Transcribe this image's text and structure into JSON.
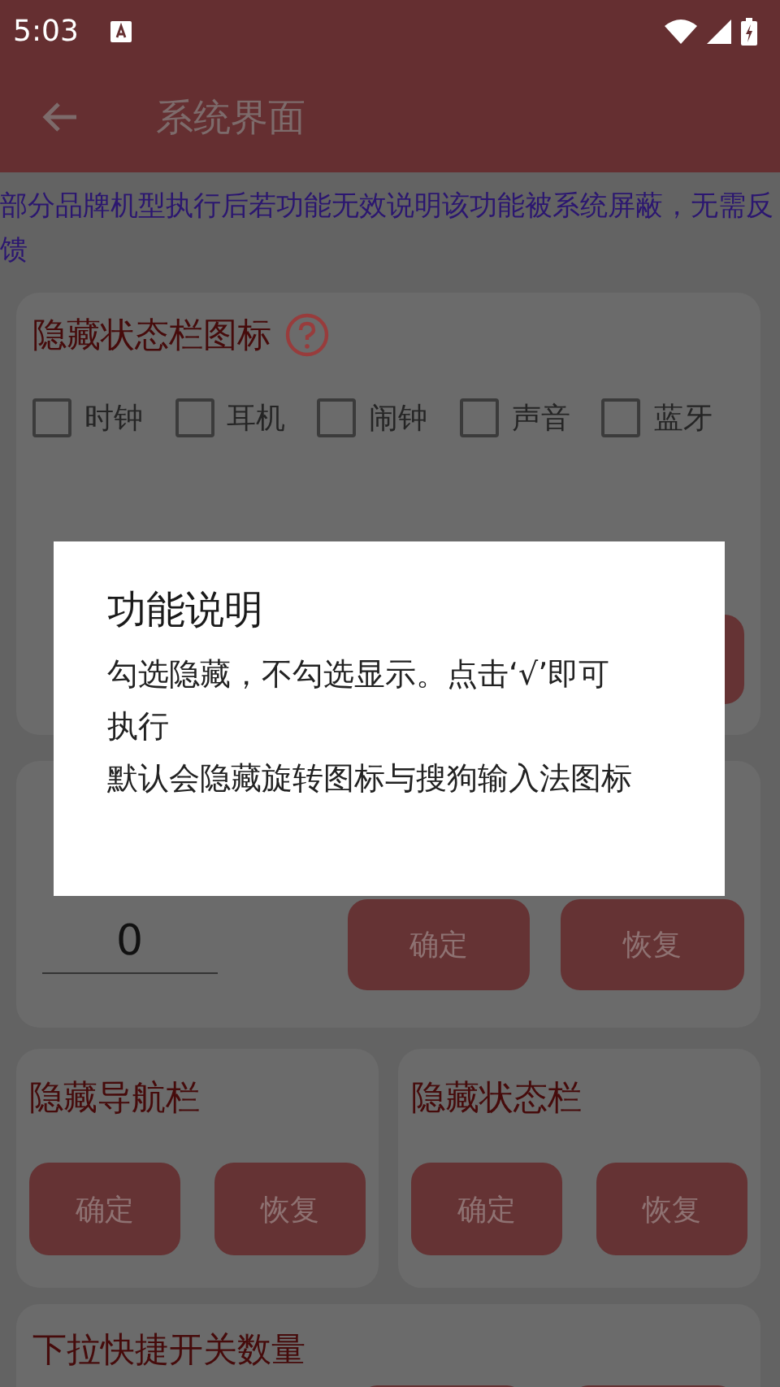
{
  "status_bar": {
    "time": "5:03"
  },
  "app_bar": {
    "title": "系统界面"
  },
  "notice": "部分品牌机型执行后若功能无效说明该功能被系统屏蔽，无需反馈",
  "icon_card": {
    "title": "隐藏状态栏图标",
    "rows": [
      [
        {
          "label": "时钟",
          "checked": false
        },
        {
          "label": "耳机",
          "checked": false
        },
        {
          "label": "闹钟",
          "checked": false
        },
        {
          "label": "声音",
          "checked": false
        },
        {
          "label": "蓝牙",
          "checked": false
        }
      ]
    ]
  },
  "left_card": {
    "value": "0",
    "buttons": [
      "确定",
      "恢复"
    ]
  },
  "half_cards": [
    {
      "title": "隐藏导航栏",
      "buttons": [
        "确定",
        "恢复"
      ]
    },
    {
      "title": "隐藏状态栏",
      "buttons": [
        "确定",
        "恢复"
      ]
    }
  ],
  "bottom_card": {
    "title": "下拉快捷开关数量"
  },
  "dialog": {
    "title": "功能说明",
    "lines": [
      "勾选隐藏，不勾选显示。点击‘√’即可执行",
      "默认会隐藏旋转图标与搜狗输入法图标"
    ]
  }
}
